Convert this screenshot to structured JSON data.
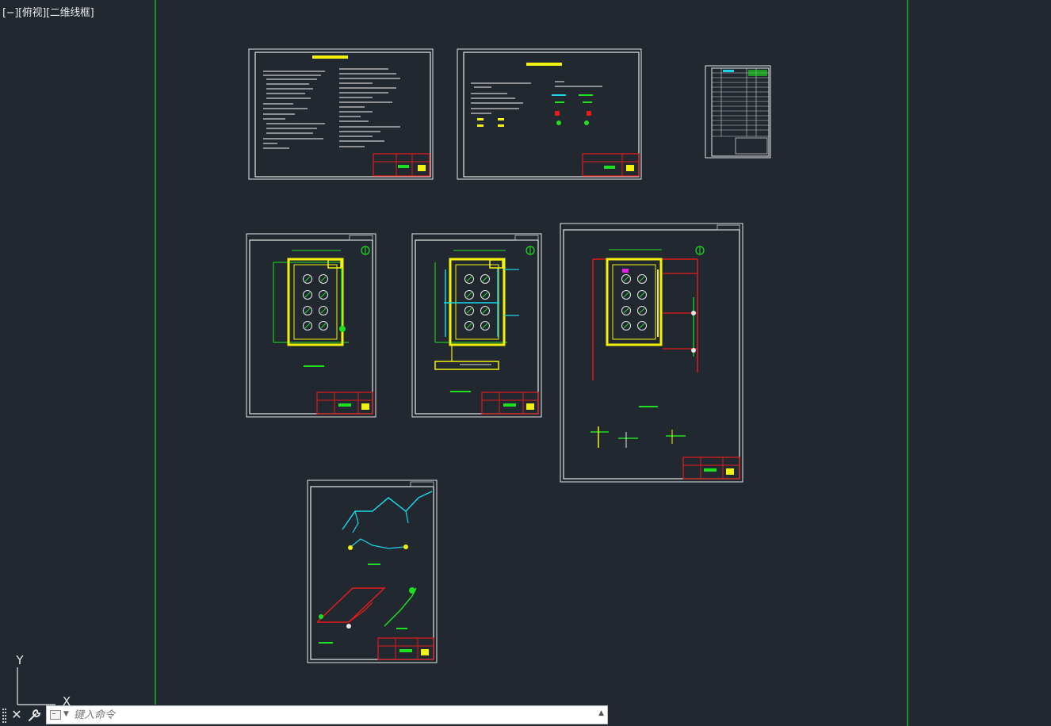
{
  "viewport": {
    "control": "[−]",
    "view": "[俯视]",
    "style": "[二维线框]"
  },
  "ucs": {
    "x_label": "X",
    "y_label": "Y"
  },
  "command_line": {
    "placeholder": "键入命令",
    "value": ""
  },
  "colors": {
    "background": "#212830",
    "viewport_border": "#21b321",
    "sheet_border": "#e8e8e8",
    "title_block": "#e31b1b",
    "highlight": "#f2f20a",
    "cyan_pipe": "#19d6e6",
    "green_pipe": "#1fe01f",
    "magenta": "#e61ee6"
  }
}
